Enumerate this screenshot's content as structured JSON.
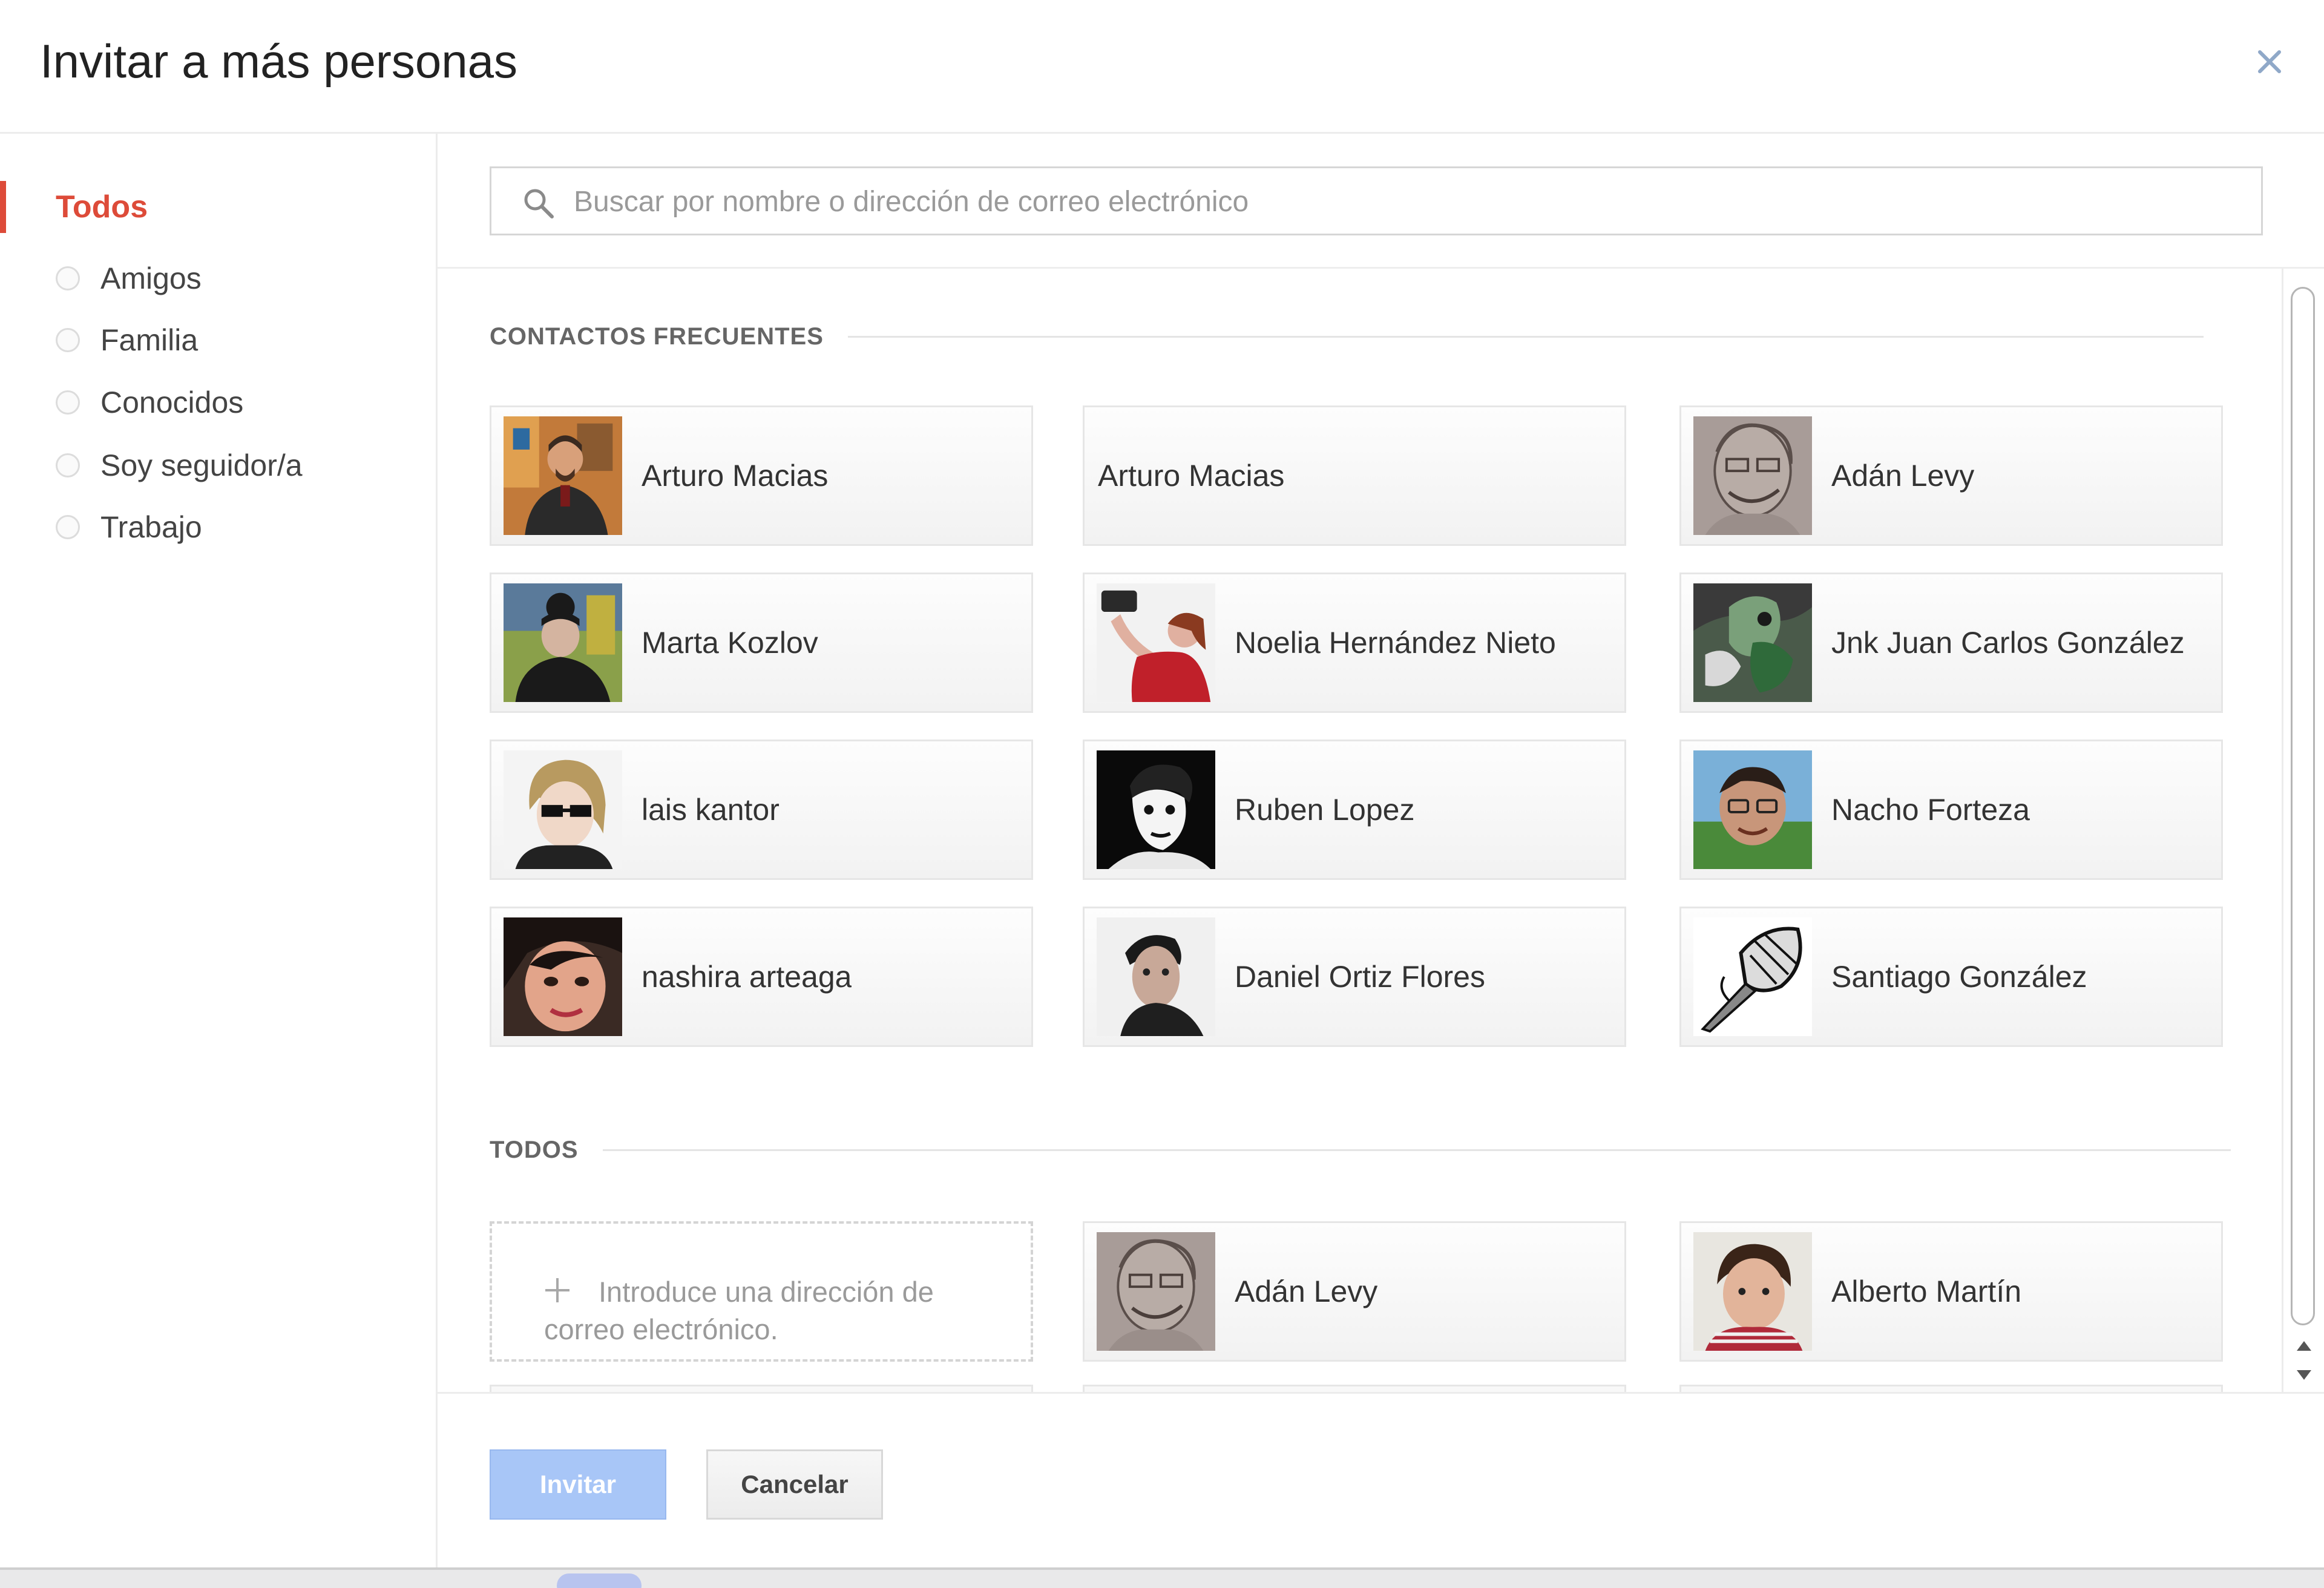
{
  "dialog": {
    "title": "Invitar a más personas",
    "close_icon": "close-icon"
  },
  "sidebar": {
    "items": [
      {
        "label": "Todos",
        "active": true
      },
      {
        "label": "Amigos"
      },
      {
        "label": "Familia"
      },
      {
        "label": "Conocidos"
      },
      {
        "label": "Soy seguidor/a"
      },
      {
        "label": "Trabajo"
      }
    ]
  },
  "search": {
    "placeholder": "Buscar por nombre o dirección de correo electrónico",
    "value": ""
  },
  "sections": {
    "frequent": {
      "title": "CONTACTOS FRECUENTES",
      "contacts": [
        {
          "name": "Arturo Macias"
        },
        {
          "name": "Arturo Macias"
        },
        {
          "name": "Adán Levy"
        },
        {
          "name": "Marta Kozlov"
        },
        {
          "name": "Noelia Hernández Nieto"
        },
        {
          "name": "Jnk Juan Carlos González"
        },
        {
          "name": "lais kantor"
        },
        {
          "name": "Ruben Lopez"
        },
        {
          "name": "Nacho Forteza"
        },
        {
          "name": "nashira arteaga"
        },
        {
          "name": "Daniel Ortiz Flores"
        },
        {
          "name": "Santiago González"
        }
      ]
    },
    "all": {
      "title": "TODOS",
      "add_email_label": "Introduce una dirección de correo electrónico.",
      "contacts": [
        {
          "name": "Adán Levy"
        },
        {
          "name": "Alberto Martín"
        }
      ]
    }
  },
  "footer": {
    "invite_label": "Invitar",
    "cancel_label": "Cancelar"
  },
  "colors": {
    "accent": "#dd4b39",
    "invite_button": "#a8c6f7"
  }
}
